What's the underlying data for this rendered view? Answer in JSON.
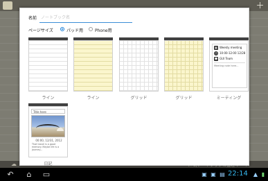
{
  "dialog": {
    "name_label": "名前",
    "name_placeholder": "ノートブック名",
    "page_size_label": "ページサイズ",
    "size_options": [
      {
        "label": "パッド用",
        "selected": true
      },
      {
        "label": "Phone用",
        "selected": false
      }
    ]
  },
  "templates": [
    {
      "label": "ライン"
    },
    {
      "label": "ライン"
    },
    {
      "label": "グリッド"
    },
    {
      "label": "グリッド"
    },
    {
      "label": "ミーティング"
    },
    {
      "label": "日記"
    }
  ],
  "meeting_preview": {
    "title": "Weekly meeting",
    "time": "10:00-12:00 12/28",
    "team": "GUI Team",
    "notes": "Meeting note here..."
  },
  "diary_preview": {
    "title": "Title here",
    "date": "00:00, 12/31, 2012",
    "text": "That travel is a good memory. Maybe life is a journey..."
  },
  "background": {
    "footer_text": "メモ/ノートブックの整理 ノート"
  },
  "statusbar": {
    "clock": "22:14"
  },
  "colors": {
    "accent": "#1a7fd8",
    "clock": "#36b8f0",
    "yellow_paper": "#fbf6cd"
  },
  "icons": [
    "app-icon",
    "add-icon",
    "back-icon",
    "home-icon",
    "recent-apps-icon",
    "notification-icon",
    "wifi-icon",
    "battery-icon"
  ]
}
